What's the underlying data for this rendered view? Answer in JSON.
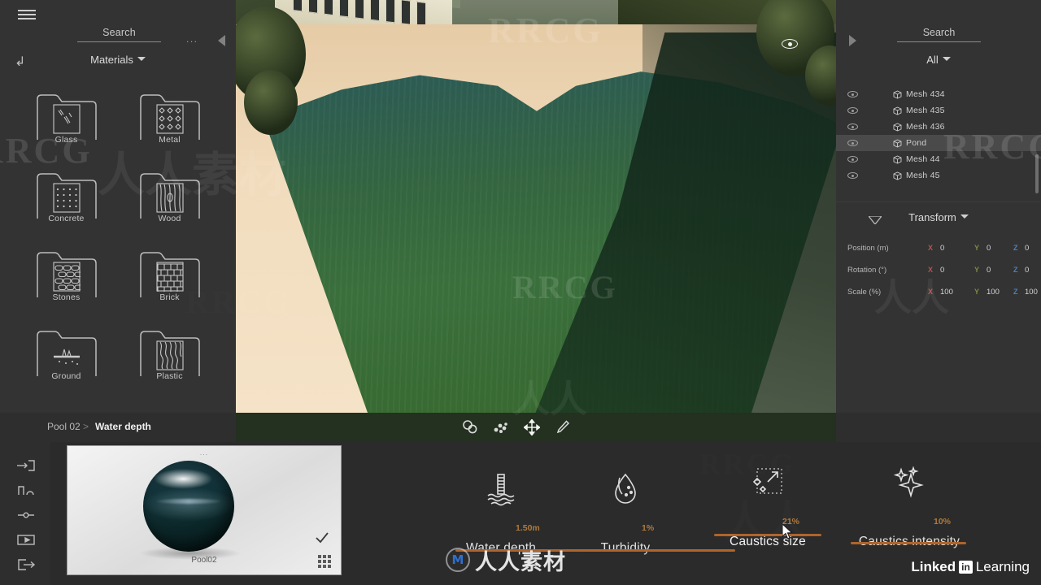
{
  "app": {
    "accent_orange": "#b0642a",
    "value_orange": "#b07a3c",
    "panel_bg": "#333333",
    "window_bg": "#2b2b2b"
  },
  "library_panel": {
    "search_label": "Search",
    "more_label": "...",
    "collapse_icon": "triangle-left-icon",
    "up_icon": "level-up-icon",
    "breadcrumb": "Materials",
    "folders": [
      {
        "label": "Glass",
        "icon": "glass-swatch-icon"
      },
      {
        "label": "Metal",
        "icon": "metal-swatch-icon"
      },
      {
        "label": "Concrete",
        "icon": "concrete-swatch-icon"
      },
      {
        "label": "Wood",
        "icon": "wood-swatch-icon"
      },
      {
        "label": "Stones",
        "icon": "stones-swatch-icon"
      },
      {
        "label": "Brick",
        "icon": "brick-swatch-icon"
      },
      {
        "label": "Ground",
        "icon": "ground-swatch-icon"
      },
      {
        "label": "Plastic",
        "icon": "plastic-swatch-icon"
      }
    ]
  },
  "viewport": {
    "eye_icon": "viewport-eye-icon",
    "tools": [
      {
        "name": "select-tool",
        "icon": "circles-icon"
      },
      {
        "name": "material-tool",
        "icon": "molecule-icon"
      },
      {
        "name": "move-tool",
        "icon": "move-arrows-icon"
      },
      {
        "name": "picker-tool",
        "icon": "eyedropper-icon"
      }
    ]
  },
  "outliner_panel": {
    "expand_icon": "triangle-right-icon",
    "search_label": "Search",
    "filter_label": "All",
    "items": [
      {
        "label": "Mesh 434",
        "visible": true,
        "selected": false
      },
      {
        "label": "Mesh 435",
        "visible": true,
        "selected": false
      },
      {
        "label": "Mesh 436",
        "visible": true,
        "selected": false
      },
      {
        "label": "Pond",
        "visible": true,
        "selected": true
      },
      {
        "label": "Mesh 44",
        "visible": true,
        "selected": false
      },
      {
        "label": "Mesh 45",
        "visible": true,
        "selected": false
      }
    ]
  },
  "transform": {
    "title": "Transform",
    "collapse_icon": "triangle-down-icon",
    "rows": [
      {
        "label": "Position (m)",
        "x": "0",
        "y": "0",
        "z": "0"
      },
      {
        "label": "Rotation (°)",
        "x": "0",
        "y": "0",
        "z": "0"
      },
      {
        "label": "Scale (%)",
        "x": "100",
        "y": "100",
        "z": "100"
      }
    ],
    "axis_labels": {
      "x": "X",
      "y": "Y",
      "z": "Z"
    },
    "axis_colors": {
      "x": "#b5544c",
      "y": "#7d8c3c",
      "z": "#4f7fb5"
    }
  },
  "statusbar": {
    "menu_icon": "hamburger-icon",
    "breadcrumb_project": "Pool 02",
    "breadcrumb_separator": ">",
    "breadcrumb_current": "Water depth"
  },
  "left_rail": {
    "items": [
      {
        "name": "import-icon"
      },
      {
        "name": "animation-curve-icon"
      },
      {
        "name": "slider-icon"
      },
      {
        "name": "render-video-icon"
      },
      {
        "name": "export-icon"
      }
    ]
  },
  "material_card": {
    "dots_label": "...",
    "name": "Pool02",
    "check_icon": "checkmark-icon",
    "grid_icon": "grid-view-icon"
  },
  "properties": [
    {
      "name": "water-depth",
      "label": "Water depth",
      "value": "1.50m",
      "icon": "depth-gauge-icon",
      "slider_fill": 0.46,
      "active": false
    },
    {
      "name": "turbidity",
      "label": "Turbidity",
      "value": "1%",
      "icon": "water-drop-icon",
      "slider_fill": 0.05,
      "active": false
    },
    {
      "name": "caustics-size",
      "label": "Caustics size",
      "value": "21%",
      "icon": "caustics-resize-icon",
      "slider_fill": 0.21,
      "active": true
    },
    {
      "name": "caustics-intensity",
      "label": "Caustics intensity",
      "value": "10%",
      "icon": "sparkle-icon",
      "slider_fill": 0.1,
      "active": false
    }
  ],
  "watermarks": {
    "rrcg": "RRCG",
    "cjk_full": "人人素材",
    "cjk_ren": "人人",
    "brand_mark": "M",
    "brand_text": "人人素材",
    "linkedin_word": "Linked",
    "linkedin_in": "in",
    "learning_word": "Learning"
  }
}
